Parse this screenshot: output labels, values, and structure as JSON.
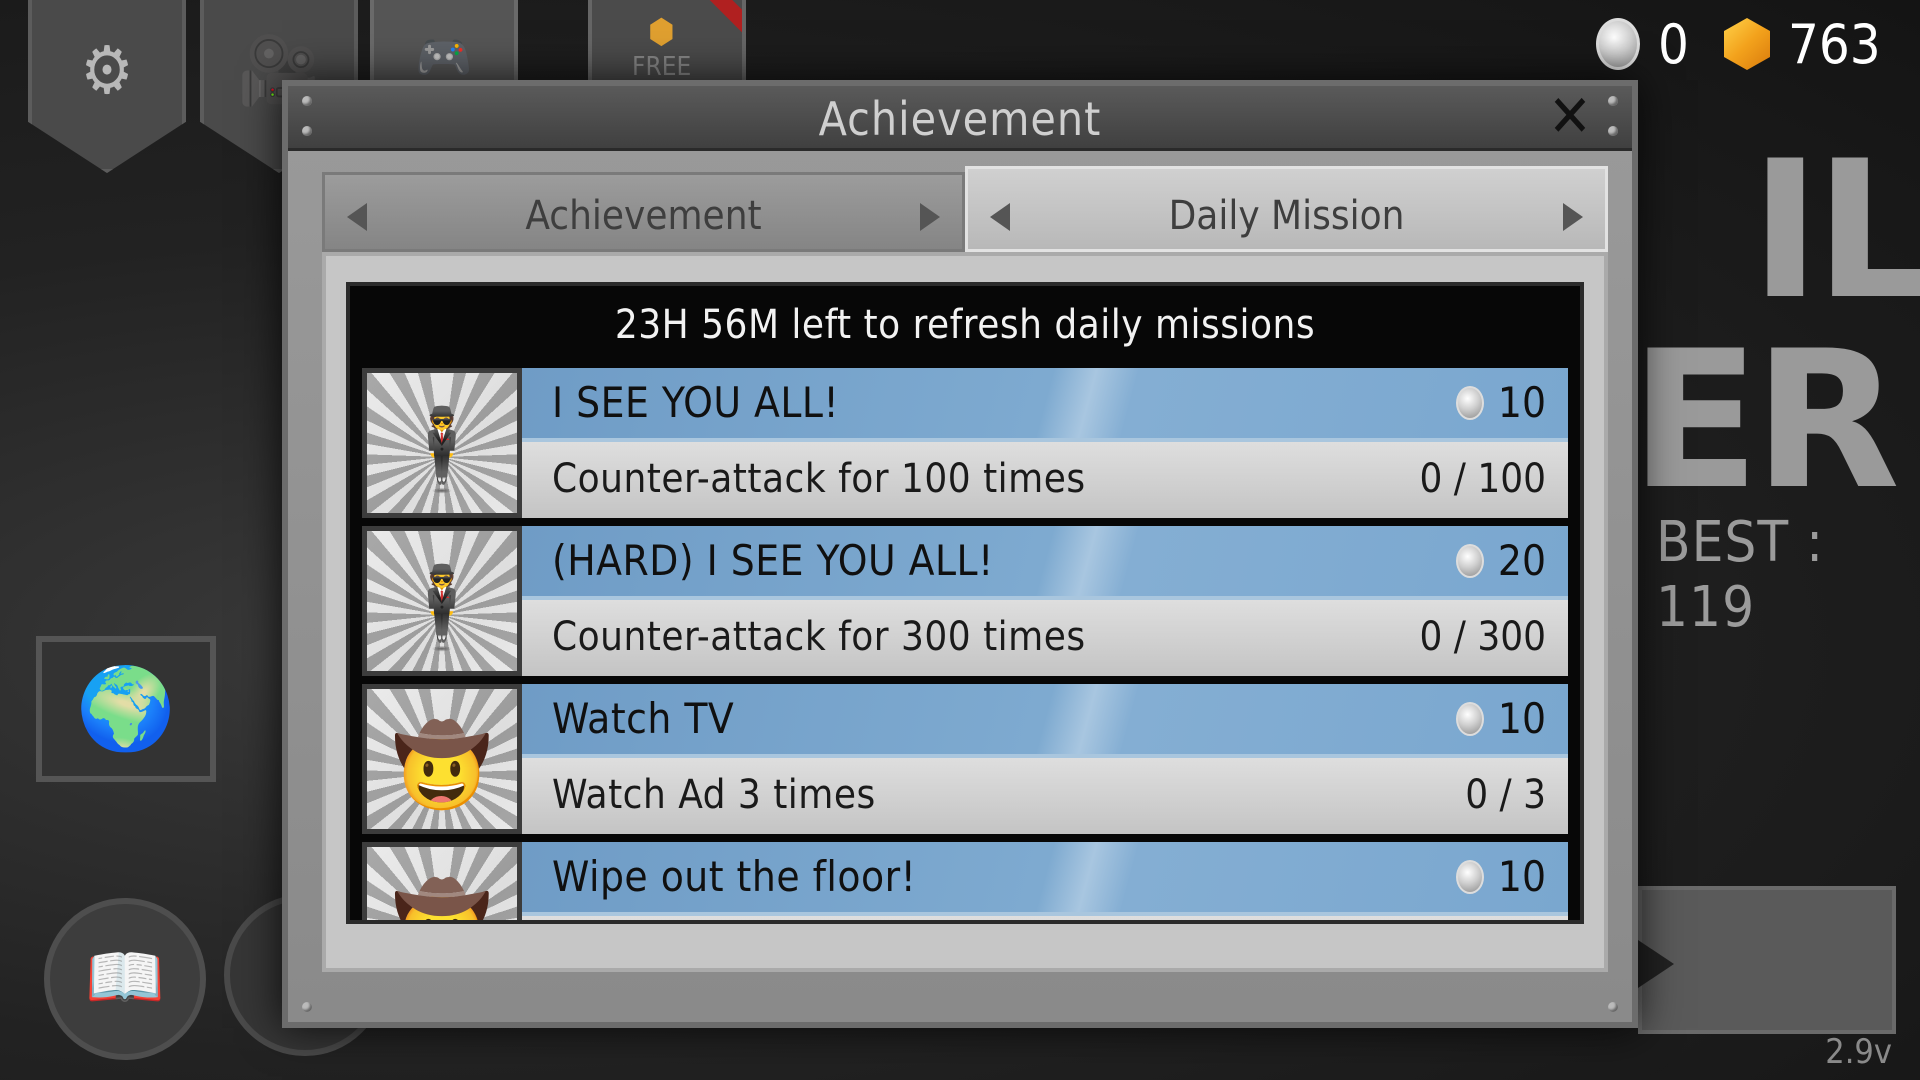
{
  "currency": {
    "silver_coins": "0",
    "gems": "763"
  },
  "background": {
    "free_tab_label": "FREE",
    "title_line1": "IL",
    "title_line2": "ER",
    "best_score": "BEST : 119",
    "version": "2.9v"
  },
  "modal": {
    "title": "Achievement",
    "tabs": [
      {
        "label": "Achievement",
        "active": false
      },
      {
        "label": "Daily Mission",
        "active": true
      }
    ],
    "refresh_text": "23H 56M left to refresh daily missions",
    "missions": [
      {
        "title": "I SEE YOU ALL!",
        "reward": "10",
        "description": "Counter-attack for 100 times",
        "progress": "0 / 100",
        "icon": "gunman-icon"
      },
      {
        "title": "(HARD) I SEE YOU ALL!",
        "reward": "20",
        "description": "Counter-attack for 300 times",
        "progress": "0 / 300",
        "icon": "gunman-icon"
      },
      {
        "title": "Watch TV",
        "reward": "10",
        "description": "Watch Ad 3 times",
        "progress": "0 / 3",
        "icon": "cowboy-icon"
      },
      {
        "title": "Wipe out the floor!",
        "reward": "10",
        "description": "",
        "progress": "",
        "icon": "cowboy-icon"
      }
    ]
  }
}
